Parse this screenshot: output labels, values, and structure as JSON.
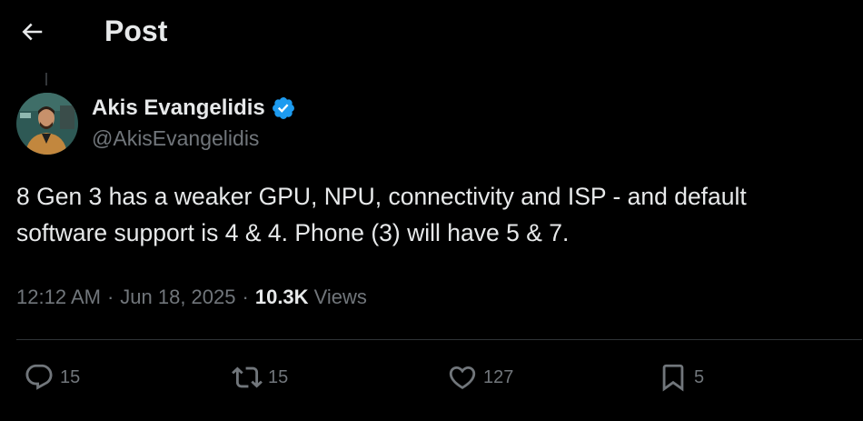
{
  "header": {
    "title": "Post",
    "back_icon": "arrow-left-icon"
  },
  "author": {
    "name": "Akis Evangelidis",
    "handle": "@AkisEvangelidis",
    "verified_color": "#1d9bf0"
  },
  "post": {
    "text": "8 Gen 3 has a weaker GPU, NPU, connectivity and ISP - and default\nsoftware support is 4 & 4. Phone (3) will have 5 & 7.",
    "time": "12:12 AM",
    "separator": "·",
    "date": "Jun 18, 2025",
    "views_count": "10.3K",
    "views_label": "Views"
  },
  "actions": {
    "replies": {
      "icon": "reply-icon",
      "count": "15"
    },
    "reposts": {
      "icon": "repost-icon",
      "count": "15"
    },
    "likes": {
      "icon": "heart-icon",
      "count": "127"
    },
    "bookmarks": {
      "icon": "bookmark-icon",
      "count": "5"
    }
  },
  "colors": {
    "background": "#000000",
    "text": "#e7e9ea",
    "muted": "#71767b",
    "divider": "#2f3336",
    "accent": "#1d9bf0"
  }
}
